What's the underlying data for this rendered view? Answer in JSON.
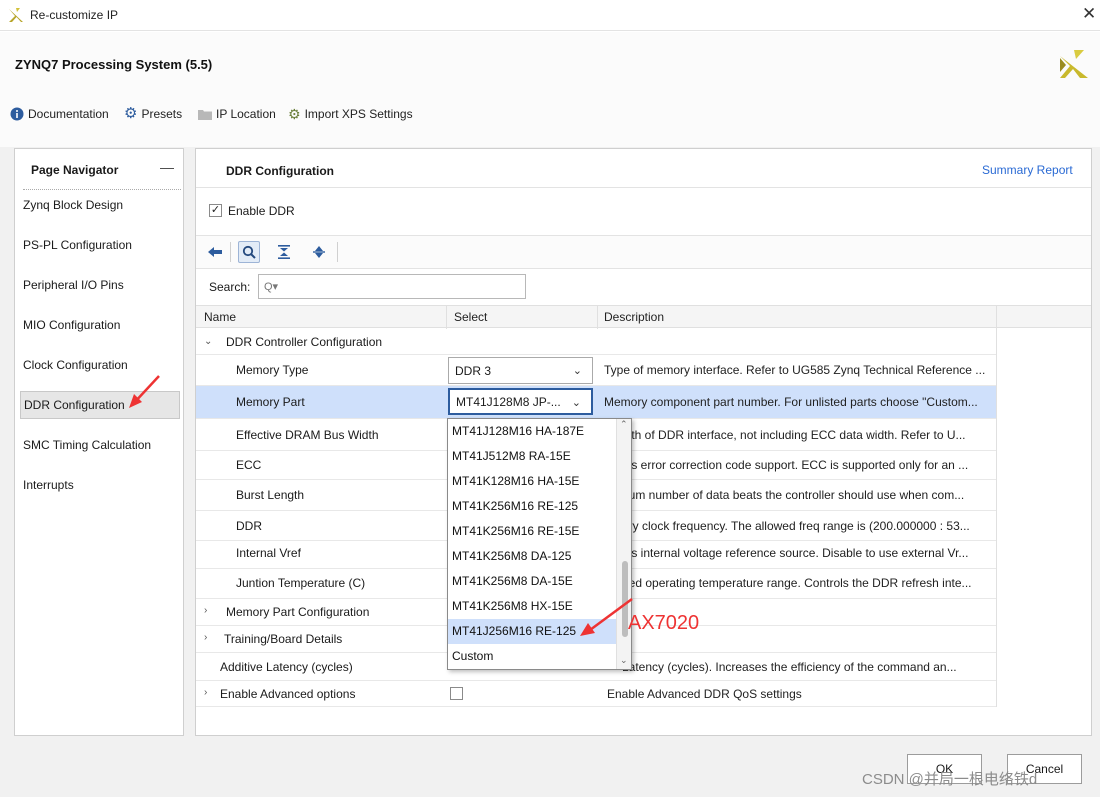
{
  "window": {
    "title": "Re-customize IP",
    "close": "✕"
  },
  "header": {
    "ip_title": "ZYNQ7 Processing System (5.5)"
  },
  "toolbar": {
    "documentation": "Documentation",
    "presets": "Presets",
    "ip_location": "IP Location",
    "import_xps": "Import XPS Settings"
  },
  "nav": {
    "title": "Page Navigator",
    "items": [
      "Zynq Block Design",
      "PS-PL Configuration",
      "Peripheral I/O Pins",
      "MIO Configuration",
      "Clock Configuration",
      "DDR Configuration",
      "SMC Timing Calculation",
      "Interrupts"
    ],
    "active": "DDR Configuration"
  },
  "panel": {
    "title": "DDR Configuration",
    "summary_link": "Summary Report",
    "enable_ddr": "Enable DDR",
    "enable_ddr_checked": true,
    "search_label": "Search:",
    "search_placeholder": "Q▾"
  },
  "table": {
    "headers": {
      "name": "Name",
      "select": "Select",
      "description": "Description"
    },
    "groups": {
      "ddr_controller": "DDR Controller Configuration",
      "memory_part_config": "Memory Part Configuration",
      "training_board": "Training/Board Details"
    },
    "rows": [
      {
        "name": "Memory Type",
        "select": "DDR 3",
        "description": "Type of memory interface. Refer to UG585 Zynq Technical Reference ..."
      },
      {
        "name": "Memory Part",
        "select": "MT41J128M8 JP-...",
        "description": "Memory component part number. For unlisted parts choose \"Custom..."
      },
      {
        "name": "Effective DRAM Bus Width",
        "description": "idth of DDR interface, not including ECC data width. Refer to U..."
      },
      {
        "name": "ECC",
        "description": "les error correction code support. ECC is supported only for an ..."
      },
      {
        "name": "Burst Length",
        "description": "num number of data beats the controller should use when com..."
      },
      {
        "name": "DDR",
        "description": "ory clock frequency. The allowed freq range is (200.000000 : 53..."
      },
      {
        "name": "Internal Vref",
        "description": "les internal voltage reference source. Disable to use external Vr..."
      },
      {
        "name": "Juntion Temperature (C)",
        "description": "ded operating temperature range. Controls the DDR refresh inte..."
      },
      {
        "name": "Additive Latency (cycles)",
        "description": "Latency (cycles). Increases the efficiency of the command an..."
      },
      {
        "name": "Enable Advanced options",
        "description": "Enable Advanced DDR QoS settings"
      }
    ]
  },
  "dropdown": {
    "options": [
      "MT41J128M16 HA-187E",
      "MT41J512M8 RA-15E",
      "MT41K128M16 HA-15E",
      "MT41K256M16 RE-125",
      "MT41K256M16 RE-15E",
      "MT41K256M8 DA-125",
      "MT41K256M8 DA-15E",
      "MT41K256M8 HX-15E",
      "MT41J256M16 RE-125",
      "Custom"
    ],
    "highlighted": "MT41J256M16 RE-125"
  },
  "annotation": {
    "label": "AX7020",
    "color": "#e33333"
  },
  "footer": {
    "ok": "OK",
    "cancel": "Cancel"
  },
  "watermark": "CSDN @并局一根电络铁d",
  "colors": {
    "accent": "#2a6ad4",
    "selection": "#cfe0fb",
    "xilinx_yellow": "#c8b52a"
  }
}
